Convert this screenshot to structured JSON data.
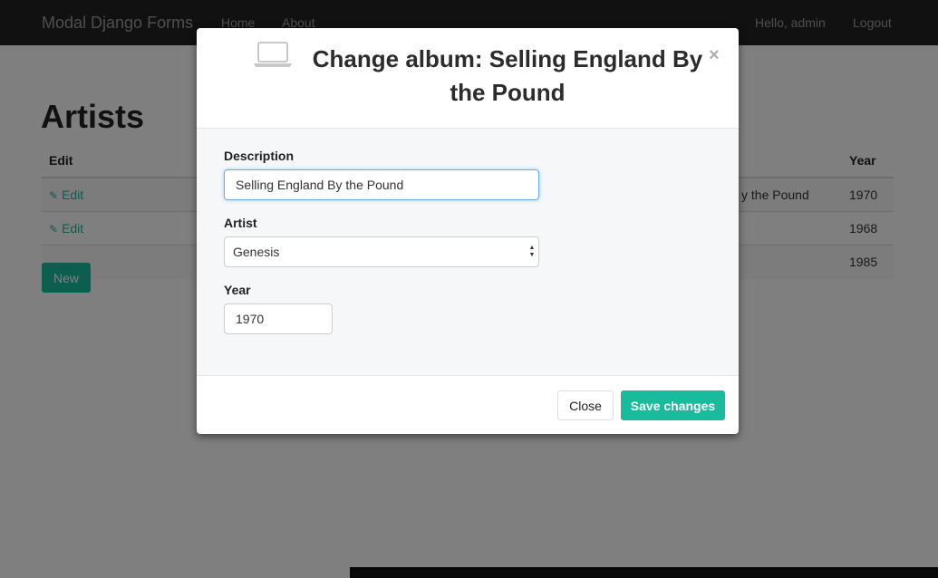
{
  "navbar": {
    "brand": "Modal Django Forms",
    "links": [
      "Home",
      "About"
    ],
    "greeting": "Hello, admin",
    "logout": "Logout"
  },
  "page": {
    "title": "Artists",
    "columns": {
      "edit": "Edit",
      "year": "Year"
    },
    "rows": [
      {
        "edit": "Edit",
        "description_fragment": "y the Pound",
        "year": "1970"
      },
      {
        "edit": "Edit",
        "year": "1968"
      },
      {
        "year": "1985"
      }
    ],
    "new_button": "New"
  },
  "modal": {
    "icon": "laptop-icon",
    "title": "Change album: Selling England By the Pound",
    "close_symbol": "×",
    "fields": {
      "description": {
        "label": "Description",
        "value": "Selling England By the Pound"
      },
      "artist": {
        "label": "Artist",
        "selected": "Genesis"
      },
      "year": {
        "label": "Year",
        "value": "1970"
      }
    },
    "footer": {
      "close": "Close",
      "save": "Save changes"
    }
  },
  "colors": {
    "accent": "#18bc9c",
    "navbar": "#222222",
    "focus_border": "#66afe9"
  }
}
